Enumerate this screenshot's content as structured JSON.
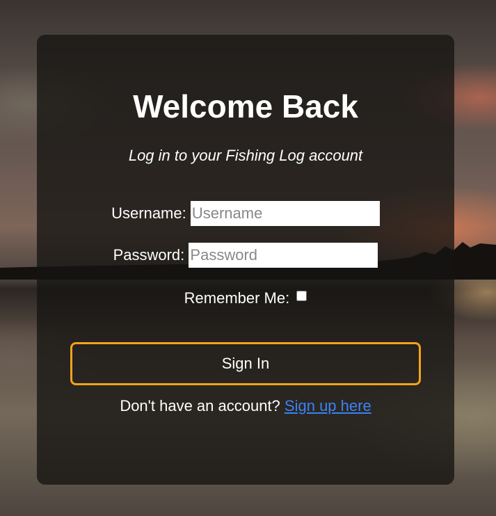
{
  "login": {
    "title": "Welcome Back",
    "subtitle": "Log in to your Fishing Log account",
    "username_label": "Username:",
    "username_placeholder": "Username",
    "username_value": "",
    "password_label": "Password:",
    "password_placeholder": "Password",
    "password_value": "",
    "remember_label": "Remember Me:",
    "remember_checked": false,
    "signin_label": "Sign In",
    "signup_prompt": "Don't have an account?",
    "signup_link": "Sign up here"
  },
  "colors": {
    "accent": "#f5a31a",
    "link": "#3b82f6",
    "card_background": "#161412"
  }
}
